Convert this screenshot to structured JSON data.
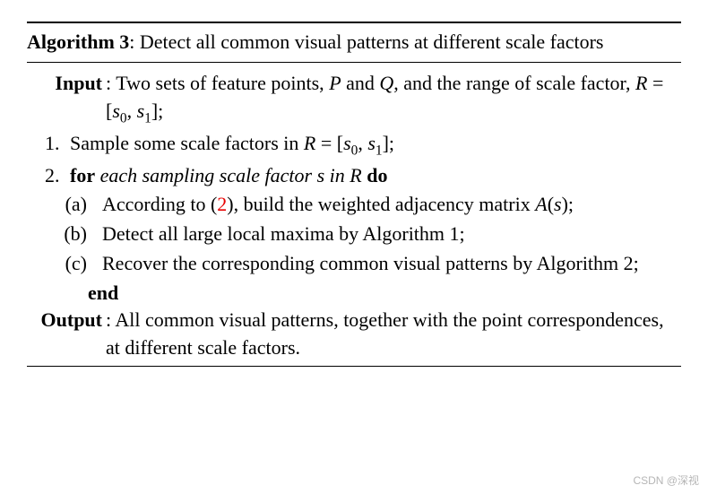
{
  "algorithm": {
    "label": "Algorithm 3",
    "title": ": Detect all common visual patterns at different scale factors",
    "input_label": "Input",
    "input_text_1": ": Two sets of feature points, ",
    "input_P": "P",
    "input_and": " and ",
    "input_Q": "Q",
    "input_text_2": ", and the range of scale factor, ",
    "input_R": "R",
    "input_eq1": " = [",
    "input_s0": "s",
    "input_s0_sub": "0",
    "input_comma1": ", ",
    "input_s1": "s",
    "input_s1_sub": "1",
    "input_close1": "];",
    "step1_a": "Sample some scale factors in ",
    "step1_R": "R",
    "step1_eq": " = [",
    "step1_s0": "s",
    "step1_s0_sub": "0",
    "step1_comma": ", ",
    "step1_s1": "s",
    "step1_s1_sub": "1",
    "step1_close": "];",
    "step2_for": "for",
    "step2_body_a": " each sampling scale factor ",
    "step2_s": "s",
    "step2_body_b": " in ",
    "step2_R": "R",
    "step2_do": " do",
    "sub_a_1": "According to (",
    "sub_a_ref": "2",
    "sub_a_2": "), build the weighted adjacency matrix ",
    "sub_a_A": "A",
    "sub_a_paren": "(",
    "sub_a_s": "s",
    "sub_a_close": ");",
    "sub_b": "Detect all large local maxima by Algorithm 1;",
    "sub_c": "Recover the corresponding common visual patterns by Algorithm 2;",
    "end": "end",
    "output_label": "Output",
    "output_text": ": All common visual patterns, together with the point correspondences, at different scale factors."
  },
  "watermark": "CSDN @深视"
}
